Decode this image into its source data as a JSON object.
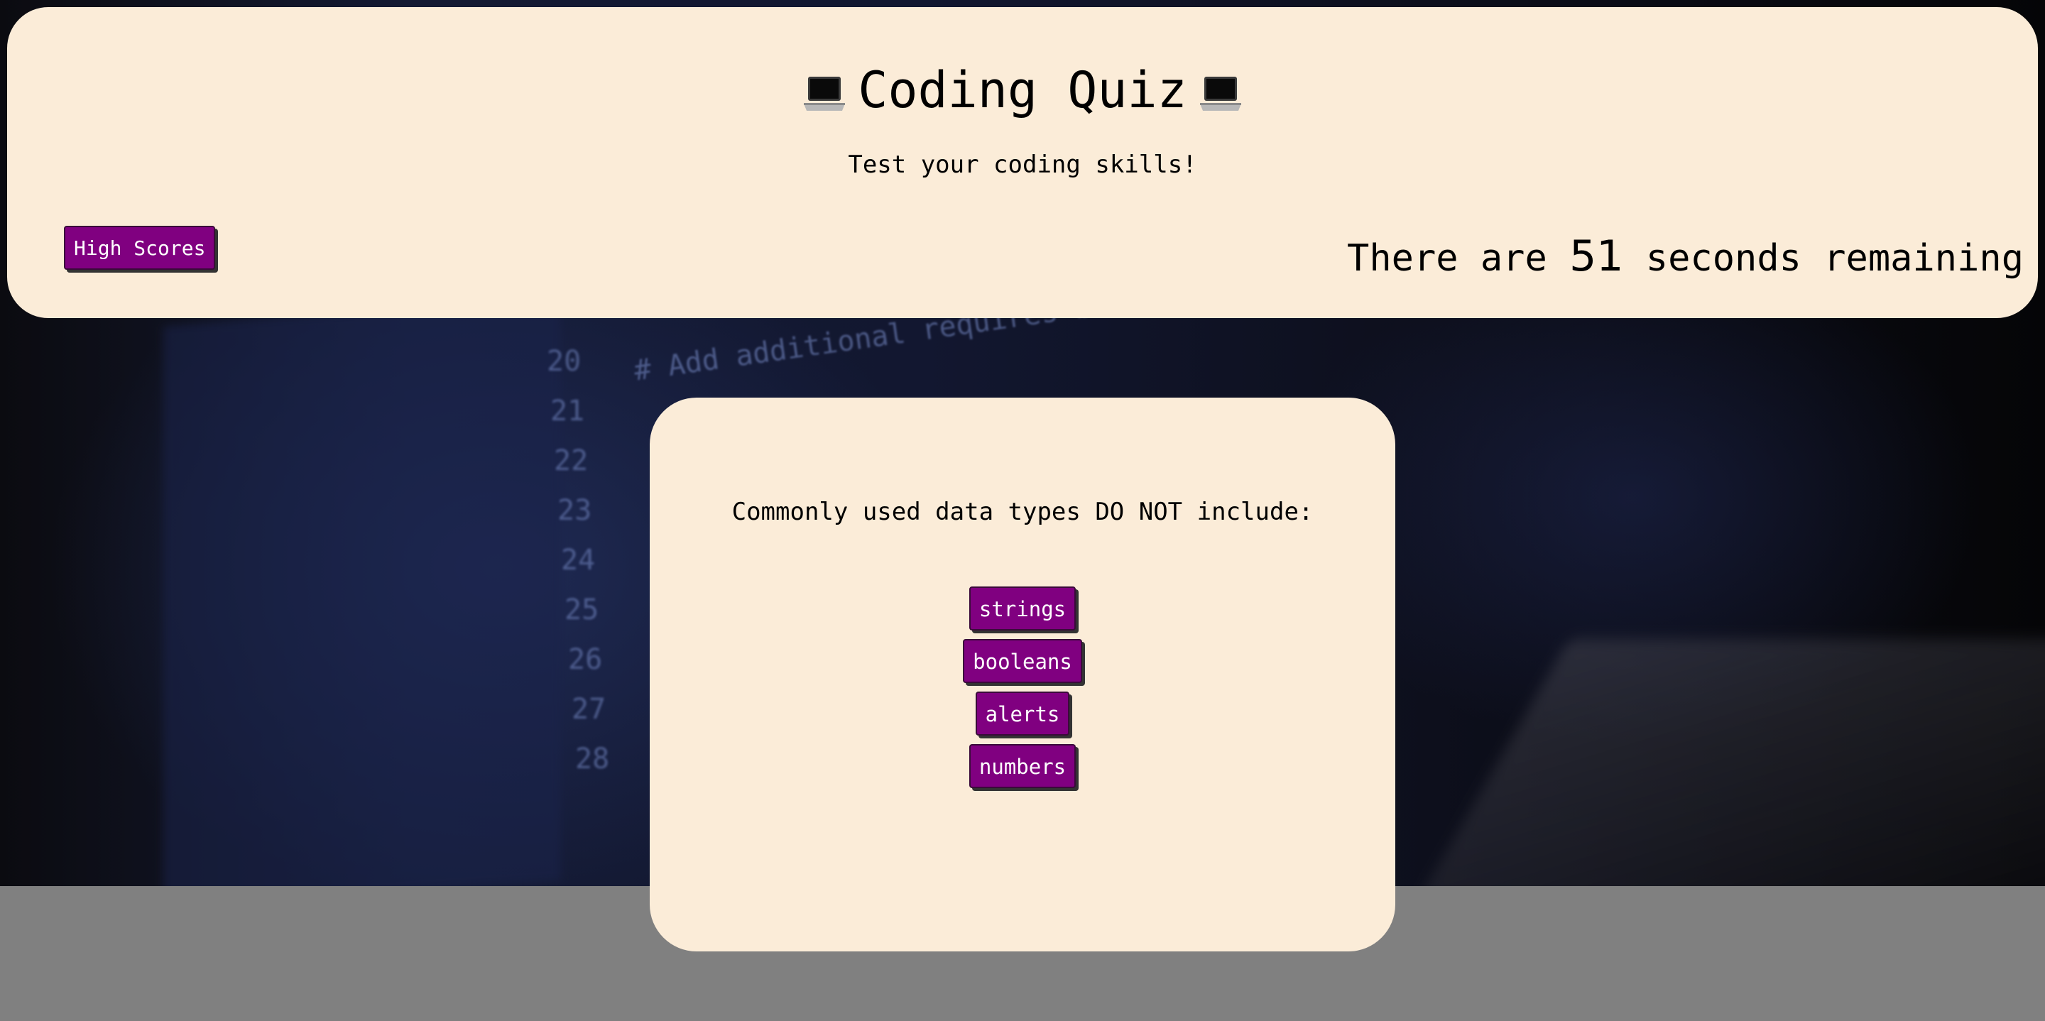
{
  "header": {
    "title": "Coding Quiz",
    "subtitle": "Test your coding skills!",
    "high_scores_label": "High Scores",
    "timer": {
      "prefix": "There are",
      "seconds": "51",
      "suffix": "seconds remaining"
    }
  },
  "quiz": {
    "question": "Commonly used data types DO NOT include:",
    "answers": [
      "strings",
      "booleans",
      "alerts",
      "numbers"
    ]
  },
  "background": {
    "line_numbers": [
      "20",
      "21",
      "22",
      "23",
      "24",
      "25",
      "26",
      "27",
      "28"
    ],
    "code_line": "# Add additional requires below"
  },
  "colors": {
    "card_bg": "#fbecd8",
    "button_bg": "#800080",
    "button_text": "#ffffff",
    "page_bottom": "#808080"
  },
  "icons": {
    "title_left": "laptop-icon",
    "title_right": "laptop-icon"
  }
}
